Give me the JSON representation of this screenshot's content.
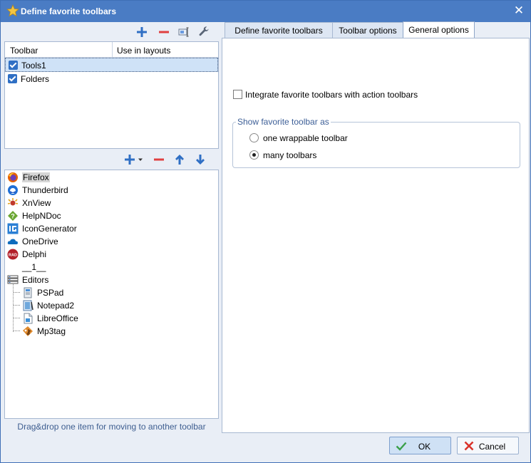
{
  "window": {
    "title": "Define favorite toolbars",
    "close_glyph": "✕"
  },
  "left": {
    "toolbar_table": {
      "columns": [
        "Toolbar",
        "Use in layouts"
      ],
      "rows": [
        {
          "name": "Tools1",
          "checked": true,
          "selected": true
        },
        {
          "name": "Folders",
          "checked": true,
          "selected": false
        }
      ]
    },
    "items": [
      {
        "label": "Firefox",
        "icon": "firefox-icon",
        "selected": true
      },
      {
        "label": "Thunderbird",
        "icon": "thunderbird-icon"
      },
      {
        "label": "XnView",
        "icon": "xnview-icon"
      },
      {
        "label": "HelpNDoc",
        "icon": "helpndoc-icon"
      },
      {
        "label": "IconGenerator",
        "icon": "icongenerator-icon"
      },
      {
        "label": "OneDrive",
        "icon": "onedrive-icon"
      },
      {
        "label": "Delphi",
        "icon": "delphi-icon"
      },
      {
        "label": "__1__",
        "icon": "separator"
      },
      {
        "label": "Editors",
        "icon": "folder-icon"
      },
      {
        "label": "PSPad",
        "icon": "pspad-icon"
      },
      {
        "label": "Notepad2",
        "icon": "notepad2-icon"
      },
      {
        "label": "LibreOffice",
        "icon": "libreoffice-icon"
      },
      {
        "label": "Mp3tag",
        "icon": "mp3tag-icon"
      }
    ],
    "status": "Drag&drop one item for moving to another toolbar"
  },
  "tabs": [
    "Define favorite toolbars",
    "Toolbar options",
    "General options"
  ],
  "active_tab": "General options",
  "general": {
    "integrate_label": "Integrate favorite toolbars with action toolbars",
    "integrate_checked": false,
    "group_title": "Show favorite toolbar as",
    "options": [
      "one wrappable toolbar",
      "many toolbars"
    ],
    "selected_option": "many toolbars"
  },
  "buttons": {
    "ok": "OK",
    "cancel": "Cancel"
  },
  "colors": {
    "title_bar": "#4a7cc4",
    "accent_blue": "#2f6fc4",
    "remove_red": "#e04040"
  }
}
